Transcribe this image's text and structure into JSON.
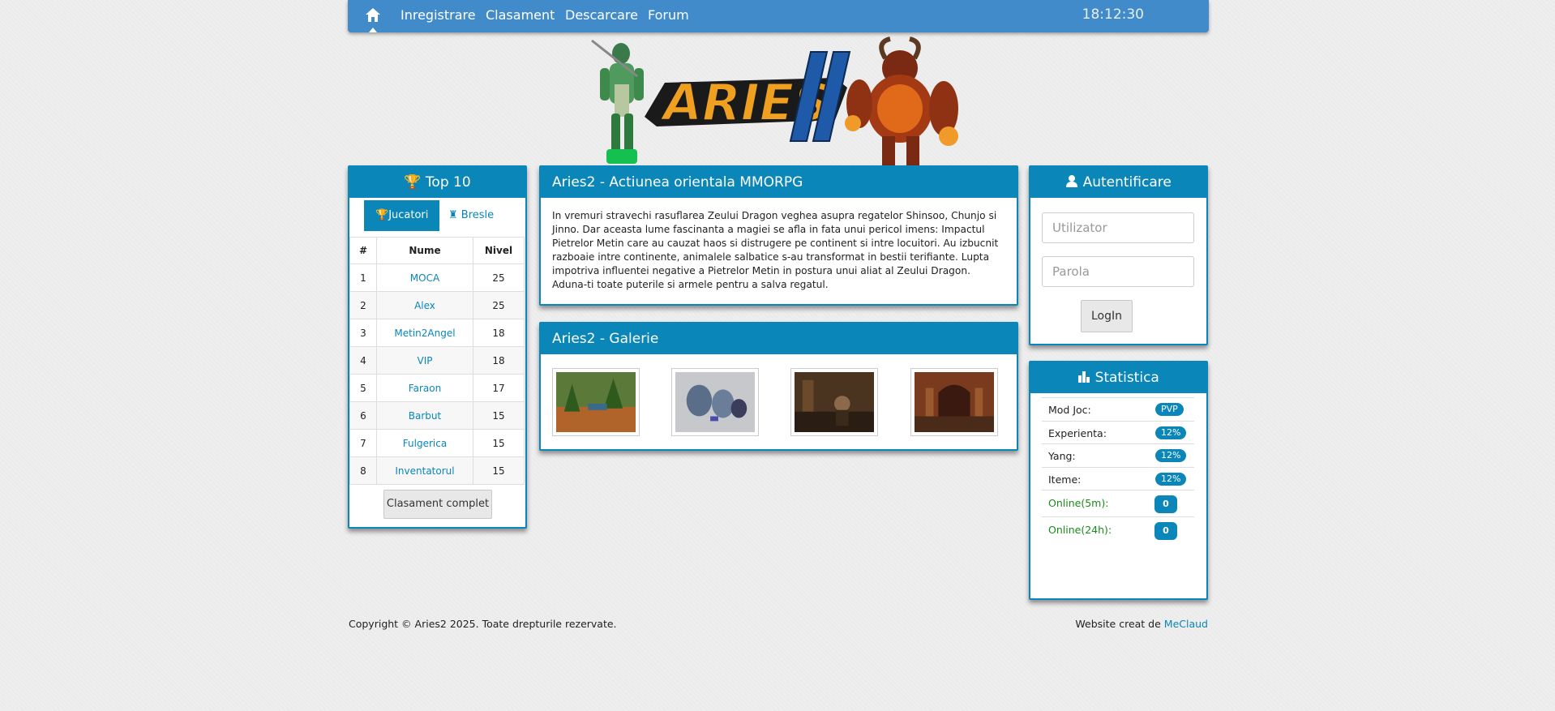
{
  "nav": {
    "items": [
      "Inregistrare",
      "Clasament",
      "Descarcare",
      "Forum"
    ],
    "clock": "18:12:30"
  },
  "colors": {
    "nav": "#428bca",
    "accent": "#0a86b8",
    "online": "#1a8a1a"
  },
  "top10": {
    "title": "Top 10",
    "tabs": [
      "Jucatori",
      "Bresle"
    ],
    "headers": [
      "#",
      "Nume",
      "Nivel"
    ],
    "rows": [
      [
        "1",
        "MOCA",
        "25"
      ],
      [
        "2",
        "Alex",
        "25"
      ],
      [
        "3",
        "Metin2Angel",
        "18"
      ],
      [
        "4",
        "VIP",
        "18"
      ],
      [
        "5",
        "Faraon",
        "17"
      ],
      [
        "6",
        "Barbut",
        "15"
      ],
      [
        "7",
        "Fulgerica",
        "15"
      ],
      [
        "8",
        "Inventatorul",
        "15"
      ]
    ],
    "button": "Clasament complet"
  },
  "article": {
    "title": "Aries2 - Actiunea orientala MMORPG",
    "body": "In vremuri stravechi rasuflarea Zeului Dragon veghea asupra regatelor Shinsoo, Chunjo si Jinno. Dar aceasta lume fascinanta a magiei se afla in fata unui pericol imens: Impactul Pietrelor Metin care au cauzat haos si distrugere pe continent si intre locuitori. Au izbucnit razboaie intre continente, animalele salbatice s-au transformat in bestii terifiante. Lupta impotriva influentei negative a Pietrelor Metin in postura unui aliat al Zeului Dragon. Aduna-ti toate puterile si armele pentru a salva regatul."
  },
  "gallery": {
    "title": "Aries2 - Galerie"
  },
  "login": {
    "title": "Autentificare",
    "user_placeholder": "Utilizator",
    "pass_placeholder": "Parola",
    "button": "LogIn"
  },
  "stats": {
    "title": "Statistica",
    "rows": [
      {
        "label": "Mod Joc:",
        "value": "PVP"
      },
      {
        "label": "Experienta:",
        "value": "12%"
      },
      {
        "label": "Yang:",
        "value": "12%"
      },
      {
        "label": "Iteme:",
        "value": "12%"
      },
      {
        "label": "Online(5m):",
        "value": "0"
      },
      {
        "label": "Online(24h):",
        "value": "0"
      }
    ]
  },
  "footer": {
    "copyright": "Copyright © Aries2 2025. Toate drepturile rezervate.",
    "credit_prefix": "Website creat de ",
    "credit_link": "MeClaud"
  }
}
